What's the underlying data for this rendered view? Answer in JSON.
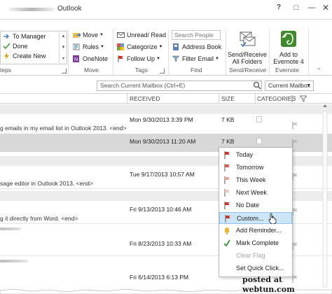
{
  "window": {
    "app_title": "Outlook"
  },
  "ribbon": {
    "quick_steps": {
      "items": [
        "To Manager",
        "Done",
        "Create New"
      ],
      "group_label": "teps"
    },
    "move": {
      "move_label": "Move",
      "rules_label": "Rules",
      "onenote_label": "OneNote",
      "group_label": "Move"
    },
    "tags": {
      "unread_read_label": "Unread/ Read",
      "categorize_label": "Categorize",
      "follow_up_label": "Follow Up",
      "group_label": "Tags"
    },
    "find": {
      "search_people_placeholder": "Search People",
      "address_book_label": "Address Book",
      "filter_email_label": "Filter Email",
      "group_label": "Find"
    },
    "send_receive": {
      "label_line1": "Send/Receive",
      "label_line2": "All Folders",
      "group_label": "Send/Receive"
    },
    "evernote": {
      "label_line1": "Add to",
      "label_line2": "Evernote 4",
      "group_label": "Evernote"
    }
  },
  "search": {
    "placeholder": "Search Current Mailbox (Ctrl+E)",
    "scope": "Current Mailbox"
  },
  "columns": {
    "received": "RECEIVED",
    "size": "SIZE",
    "categories": "CATEGORIES"
  },
  "emails": [
    {
      "received": "Mon 9/30/2013 3:39 PM",
      "size": "7 KB",
      "preview": "g emails in my email list in Outlook 2013. <end>"
    },
    {
      "received": "Mon 9/30/2013 11:20 AM",
      "size": "7 KB",
      "preview": ""
    },
    {
      "received": "Tue 9/17/2013 10:57 AM",
      "size": "",
      "preview": "sage editor in Outlook 2013. <end>"
    },
    {
      "received": "Fri 9/13/2013 10:46 AM",
      "size": "",
      "preview": "g it directly from Word. <end>"
    },
    {
      "received": "Fri 8/23/2013 10:33 AM",
      "size": "",
      "preview": ""
    },
    {
      "received": "Fri 6/14/2013 6:13 PM",
      "size": "",
      "preview": ""
    }
  ],
  "follow_up_menu": {
    "items": [
      {
        "label": "Today",
        "icon": "red-flag-icon"
      },
      {
        "label": "Tomorrow",
        "icon": "red-flag-icon"
      },
      {
        "label": "This Week",
        "icon": "pink-flag-icon"
      },
      {
        "label": "Next Week",
        "icon": "pink-flag-icon"
      },
      {
        "label": "No Date",
        "icon": "red-flag-icon"
      },
      {
        "label": "Custom...",
        "icon": "red-flag-icon"
      },
      {
        "label": "Add Reminder...",
        "icon": "bell-icon"
      },
      {
        "label": "Mark Complete",
        "icon": "checkmark-icon"
      },
      {
        "label": "Clear Flag",
        "icon": ""
      },
      {
        "label": "Set Quick Click...",
        "icon": ""
      }
    ]
  },
  "watermark": {
    "line1": "posted at webtun.com"
  },
  "colors": {
    "flag_red": "#c0392b",
    "flag_pink": "#e8a59b",
    "menu_highlight": "#cde6f7",
    "check_green": "#3d8f3d",
    "evernote_green": "#3e8a2d",
    "selection": "#d7d7d7"
  }
}
